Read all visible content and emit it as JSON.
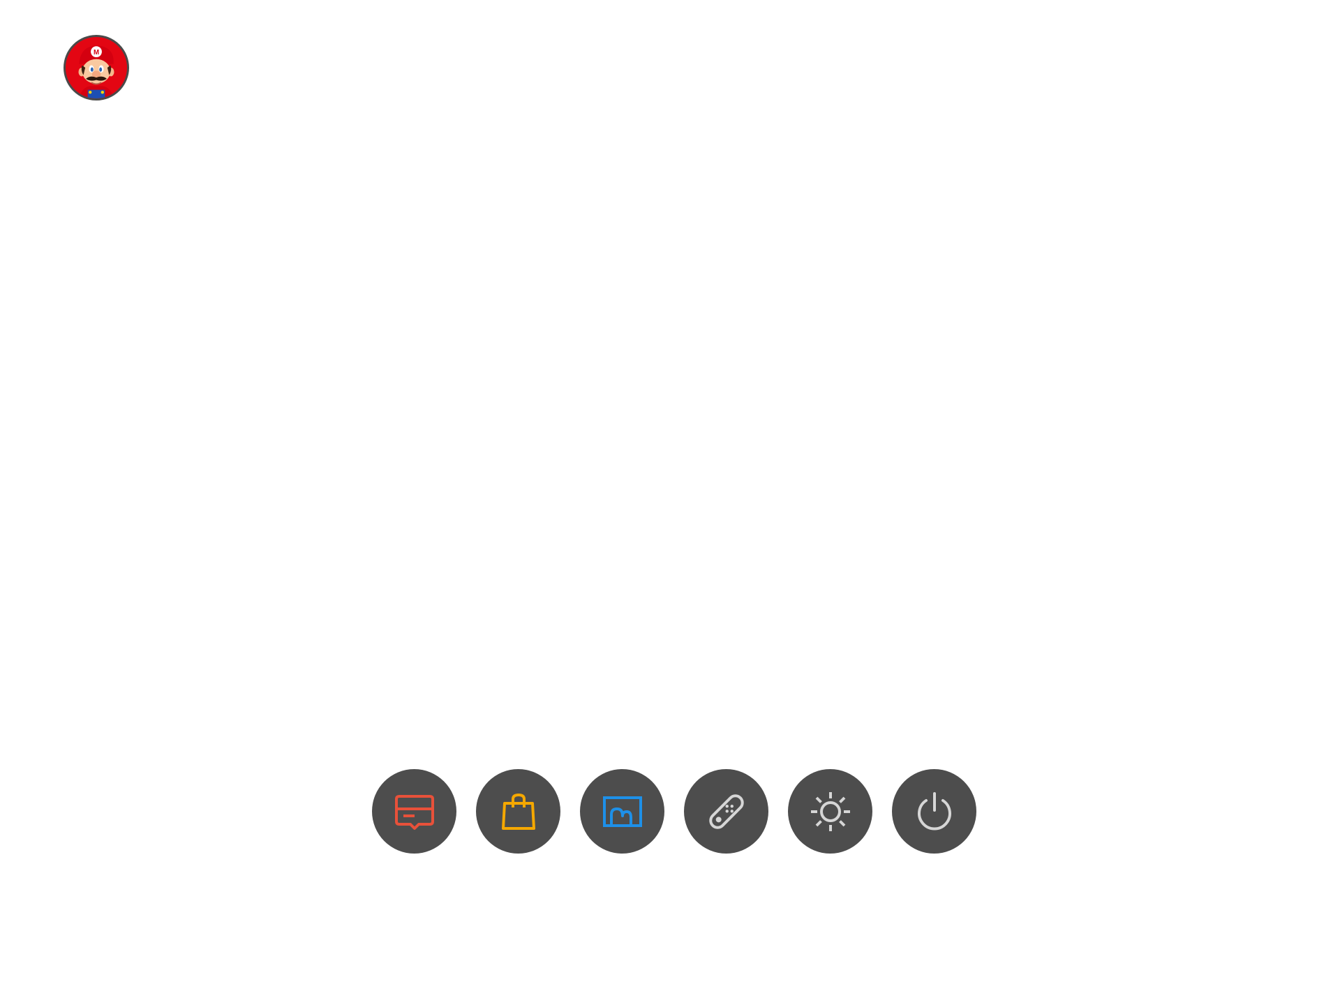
{
  "user": {
    "avatar_icon": "mario-avatar-icon",
    "avatar_color": "#e30613"
  },
  "dock": {
    "items": [
      {
        "name": "news",
        "icon": "news-icon",
        "color": "#e8513a"
      },
      {
        "name": "eshop",
        "icon": "shopping-bag-icon",
        "color": "#f5a800"
      },
      {
        "name": "album",
        "icon": "album-icon",
        "color": "#1e90e8"
      },
      {
        "name": "controllers",
        "icon": "controller-icon",
        "color": "#d6d6d6"
      },
      {
        "name": "system-settings",
        "icon": "gear-icon",
        "color": "#d6d6d6"
      },
      {
        "name": "sleep-mode",
        "icon": "power-icon",
        "color": "#d6d6d6"
      }
    ],
    "button_color": "#4d4d4d"
  }
}
